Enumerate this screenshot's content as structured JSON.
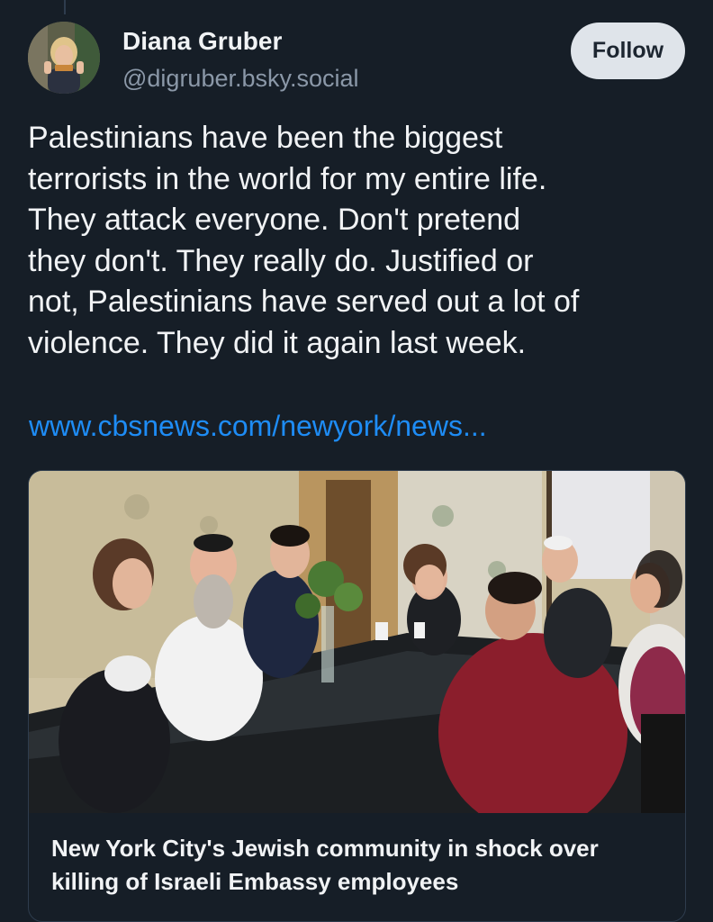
{
  "post": {
    "author": {
      "display_name": "Diana Gruber",
      "handle": "@digruber.bsky.social"
    },
    "follow_label": "Follow",
    "text": "Palestinians have been the biggest\nterrorists in the world for my entire life.\nThey attack everyone. Don't pretend\nthey don't. They really do. Justified or\nnot, Palestinians have served out a lot of\nviolence. They did it again last week.",
    "link_text": "www.cbsnews.com/newyork/news...",
    "link_card": {
      "title": "New York City's Jewish community in shock over killing of Israeli Embassy employees"
    }
  },
  "colors": {
    "background": "#161e27",
    "link": "#1e8cf5",
    "handle": "#8b98a8",
    "follow_button_bg": "#dfe4ea"
  }
}
